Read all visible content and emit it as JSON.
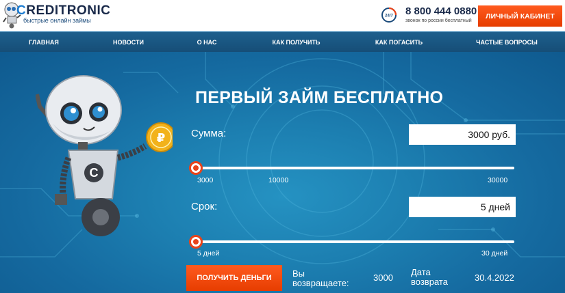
{
  "header": {
    "logo_word_rest": "REDITRONIC",
    "logo_word_first": "C",
    "logo_tagline": "быстрые онлайн займы",
    "phone_badge": "24/7",
    "phone": "8 800 444 0880",
    "phone_note": "звонок по россии бесплатный",
    "cabinet_label": "ЛИЧНЫЙ КАБИНЕТ"
  },
  "nav": {
    "items": [
      "ГЛАВНАЯ",
      "НОВОСТИ",
      "О НАС",
      "КАК ПОЛУЧИТЬ",
      "КАК ПОГАСИТЬ",
      "ЧАСТЫЕ ВОПРОСЫ"
    ]
  },
  "hero": {
    "title": "ПЕРВЫЙ ЗАЙМ БЕСПЛАТНО",
    "coin_symbol": "₽",
    "robot_badge": "C",
    "amount": {
      "label": "Сумма:",
      "value": "3000 руб.",
      "ticks": [
        "3000",
        "10000",
        "30000"
      ],
      "slider_fraction": 0
    },
    "term": {
      "label": "Срок:",
      "value": "5 дней",
      "ticks": [
        "5 дней",
        "30 дней"
      ],
      "slider_fraction": 0
    },
    "get_button": "ПОЛУЧИТЬ ДЕНЬГИ",
    "return_label_line1": "Вы",
    "return_label_line2": "возвращаете:",
    "return_value": "3000",
    "date_label_line1": "Дата",
    "date_label_line2": "возврата",
    "date_value": "30.4.2022"
  },
  "colors": {
    "accent": "#e8431a",
    "nav_bg": "#1d5f8d",
    "hero_bg": "#1c7eb0"
  }
}
